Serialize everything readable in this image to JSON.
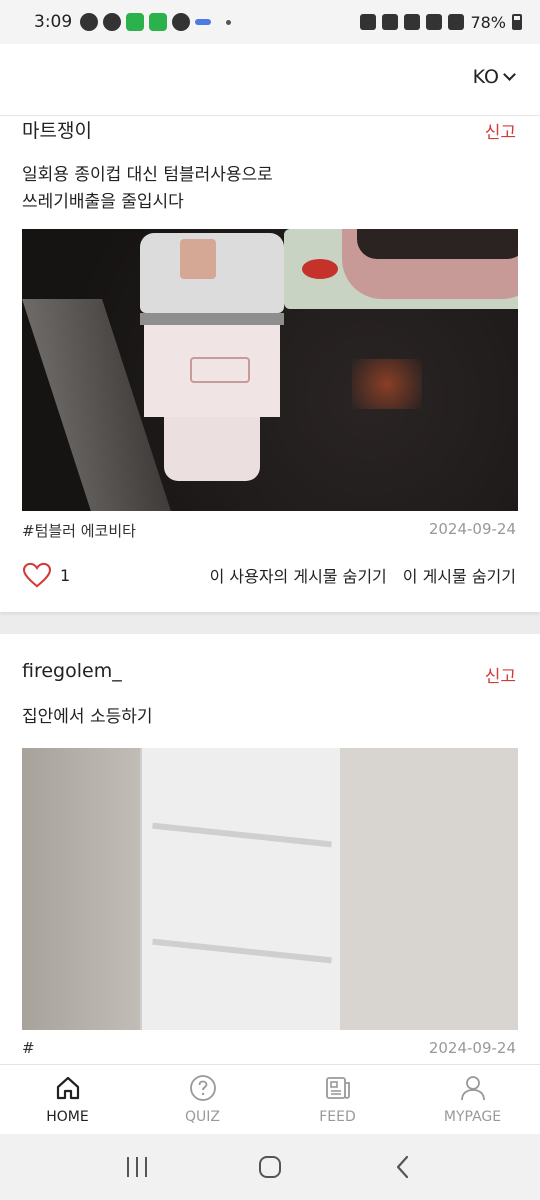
{
  "status_bar": {
    "time": "3:09",
    "battery": "78%"
  },
  "header": {
    "language": "KO"
  },
  "posts": [
    {
      "author": "마트쟁이",
      "report_label": "신고",
      "text_line1": "일회용 종이컵 대신 텀블러사용으로",
      "text_line2": "쓰레기배출을 줄입시다",
      "tag": "#텀블러 에코비타",
      "date": "2024-09-24",
      "like_count": "1",
      "hide_user_label": "이 사용자의 게시물 숨기기",
      "hide_post_label": "이 게시물 숨기기"
    },
    {
      "author": "firegolem_",
      "report_label": "신고",
      "text_line1": "집안에서 소등하기",
      "tag": "#",
      "date": "2024-09-24"
    }
  ],
  "bottom_nav": {
    "items": [
      {
        "label": "HOME",
        "icon": "home-icon",
        "active": true
      },
      {
        "label": "QUIZ",
        "icon": "quiz-icon",
        "active": false
      },
      {
        "label": "FEED",
        "icon": "feed-icon",
        "active": false
      },
      {
        "label": "MYPAGE",
        "icon": "mypage-icon",
        "active": false
      }
    ]
  },
  "colors": {
    "report": "#d33b3b",
    "heart": "#d33b3b",
    "muted": "#999999"
  }
}
